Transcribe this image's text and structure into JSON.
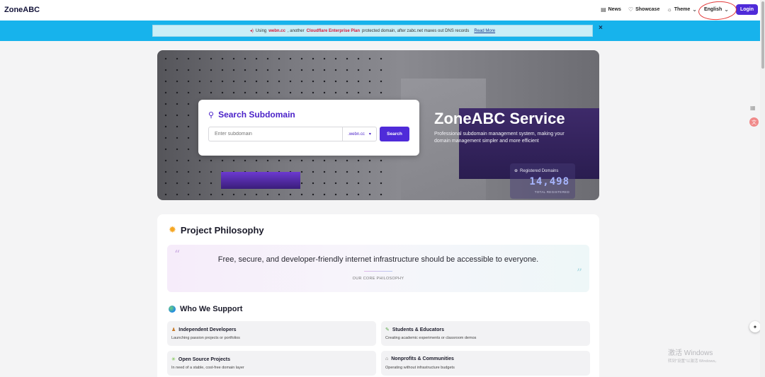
{
  "nav": {
    "brand": "ZoneABC",
    "news": "News",
    "showcase": "Showcase",
    "theme": "Theme",
    "language": "English",
    "login": "Login"
  },
  "announcement": {
    "prefix": "Using",
    "domain": "webn.cc",
    "middle": ", another",
    "plan": "Cloudflare Enterprise Plan",
    "suffix": "protected domain, after zabc.net maxes out DNS records",
    "read_more": "Read More",
    "close": "×"
  },
  "search": {
    "title": "Search Subdomain",
    "placeholder": "Enter subdomain",
    "suffix": ".webn.cc",
    "button": "Search"
  },
  "hero": {
    "title": "ZoneABC Service",
    "subtitle": "Professional subdomain management system, making your domain management simpler and more efficient",
    "stat_label": "Registered Domains",
    "stat_value": "14,498",
    "stat_caption": "TOTAL REGISTERED"
  },
  "philosophy": {
    "title": "Project Philosophy",
    "quote": "Free, secure, and developer-friendly internet infrastructure should be accessible to everyone.",
    "caption": "OUR CORE PHILOSOPHY"
  },
  "who": {
    "title": "Who We Support",
    "items": [
      {
        "title": "Independent Developers",
        "desc": "Launching passion projects or portfolios",
        "icon": "person-icon"
      },
      {
        "title": "Students & Educators",
        "desc": "Creating academic experiments or classroom demos",
        "icon": "pencil-icon"
      },
      {
        "title": "Open Source Projects",
        "desc": "In need of a stable, cost-free domain layer",
        "icon": "sparkle-icon"
      },
      {
        "title": "Nonprofits & Communities",
        "desc": "Operating without infrastructure budgets",
        "icon": "building-icon"
      }
    ]
  },
  "watermark": {
    "line1": "激活 Windows",
    "line2": "转到\"设置\"以激活 Windows。"
  },
  "colors": {
    "accent": "#4f2bd9",
    "banner": "#17b3ec",
    "highlight": "#d81b3a"
  }
}
